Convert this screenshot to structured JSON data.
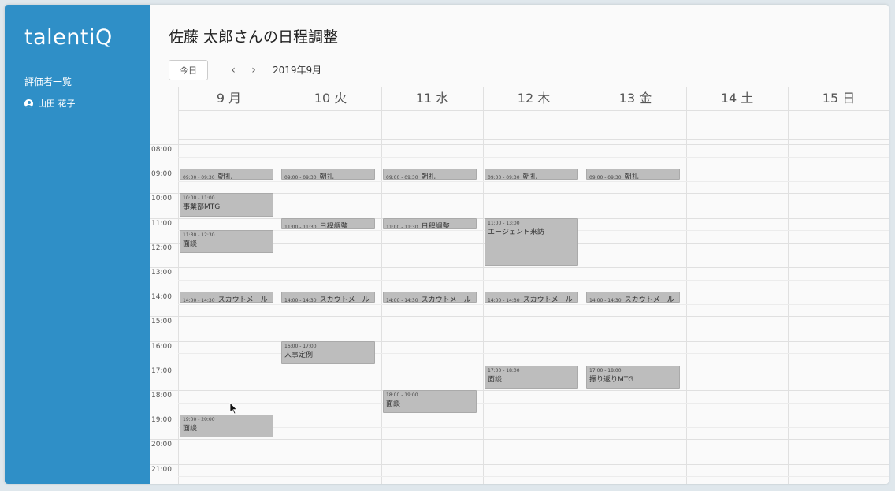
{
  "app": {
    "logo": "talentiQ",
    "sidebar_heading": "評価者一覧",
    "sidebar_user": "山田 花子",
    "title": "佐藤 太郎さんの日程調整",
    "today_label": "今日",
    "prev_icon": "‹",
    "next_icon": "›",
    "month_label": "2019年9月"
  },
  "colors": {
    "sidebar": "#2f8fc7",
    "event_bg": "#bdbdbd"
  },
  "days": [
    {
      "label": "9 月"
    },
    {
      "label": "10 火"
    },
    {
      "label": "11 水"
    },
    {
      "label": "12 木"
    },
    {
      "label": "13 金"
    },
    {
      "label": "14 土"
    },
    {
      "label": "15 日"
    }
  ],
  "hours": [
    "08:00",
    "09:00",
    "10:00",
    "11:00",
    "12:00",
    "13:00",
    "14:00",
    "15:00",
    "16:00",
    "17:00",
    "18:00",
    "19:00",
    "20:00",
    "21:00"
  ],
  "events": [
    {
      "day": 0,
      "start": "09:00",
      "end": "09:30",
      "time": "09:00 - 09:30",
      "title": "朝礼"
    },
    {
      "day": 1,
      "start": "09:00",
      "end": "09:30",
      "time": "09:00 - 09:30",
      "title": "朝礼"
    },
    {
      "day": 2,
      "start": "09:00",
      "end": "09:30",
      "time": "09:00 - 09:30",
      "title": "朝礼"
    },
    {
      "day": 3,
      "start": "09:00",
      "end": "09:30",
      "time": "09:00 - 09:30",
      "title": "朝礼"
    },
    {
      "day": 4,
      "start": "09:00",
      "end": "09:30",
      "time": "09:00 - 09:30",
      "title": "朝礼"
    },
    {
      "day": 0,
      "start": "10:00",
      "end": "11:00",
      "time": "10:00 - 11:00",
      "title": "事業部MTG"
    },
    {
      "day": 0,
      "start": "11:30",
      "end": "12:30",
      "time": "11:30 - 12:30",
      "title": "面談"
    },
    {
      "day": 1,
      "start": "11:00",
      "end": "11:30",
      "time": "11:00 - 11:30",
      "title": "日程調整"
    },
    {
      "day": 2,
      "start": "11:00",
      "end": "11:30",
      "time": "11:00 - 11:30",
      "title": "日程調整"
    },
    {
      "day": 3,
      "start": "11:00",
      "end": "13:00",
      "time": "11:00 - 13:00",
      "title": "エージェント来訪"
    },
    {
      "day": 0,
      "start": "14:00",
      "end": "14:30",
      "time": "14:00 - 14:30",
      "title": "スカウトメール"
    },
    {
      "day": 1,
      "start": "14:00",
      "end": "14:30",
      "time": "14:00 - 14:30",
      "title": "スカウトメール"
    },
    {
      "day": 2,
      "start": "14:00",
      "end": "14:30",
      "time": "14:00 - 14:30",
      "title": "スカウトメール"
    },
    {
      "day": 3,
      "start": "14:00",
      "end": "14:30",
      "time": "14:00 - 14:30",
      "title": "スカウトメール"
    },
    {
      "day": 4,
      "start": "14:00",
      "end": "14:30",
      "time": "14:00 - 14:30",
      "title": "スカウトメール"
    },
    {
      "day": 1,
      "start": "16:00",
      "end": "17:00",
      "time": "16:00 - 17:00",
      "title": "人事定例"
    },
    {
      "day": 3,
      "start": "17:00",
      "end": "18:00",
      "time": "17:00 - 18:00",
      "title": "面談"
    },
    {
      "day": 4,
      "start": "17:00",
      "end": "18:00",
      "time": "17:00 - 18:00",
      "title": "振り返りMTG"
    },
    {
      "day": 2,
      "start": "18:00",
      "end": "19:00",
      "time": "18:00 - 19:00",
      "title": "面談"
    },
    {
      "day": 0,
      "start": "19:00",
      "end": "20:00",
      "time": "19:00 - 20:00",
      "title": "面談"
    }
  ]
}
